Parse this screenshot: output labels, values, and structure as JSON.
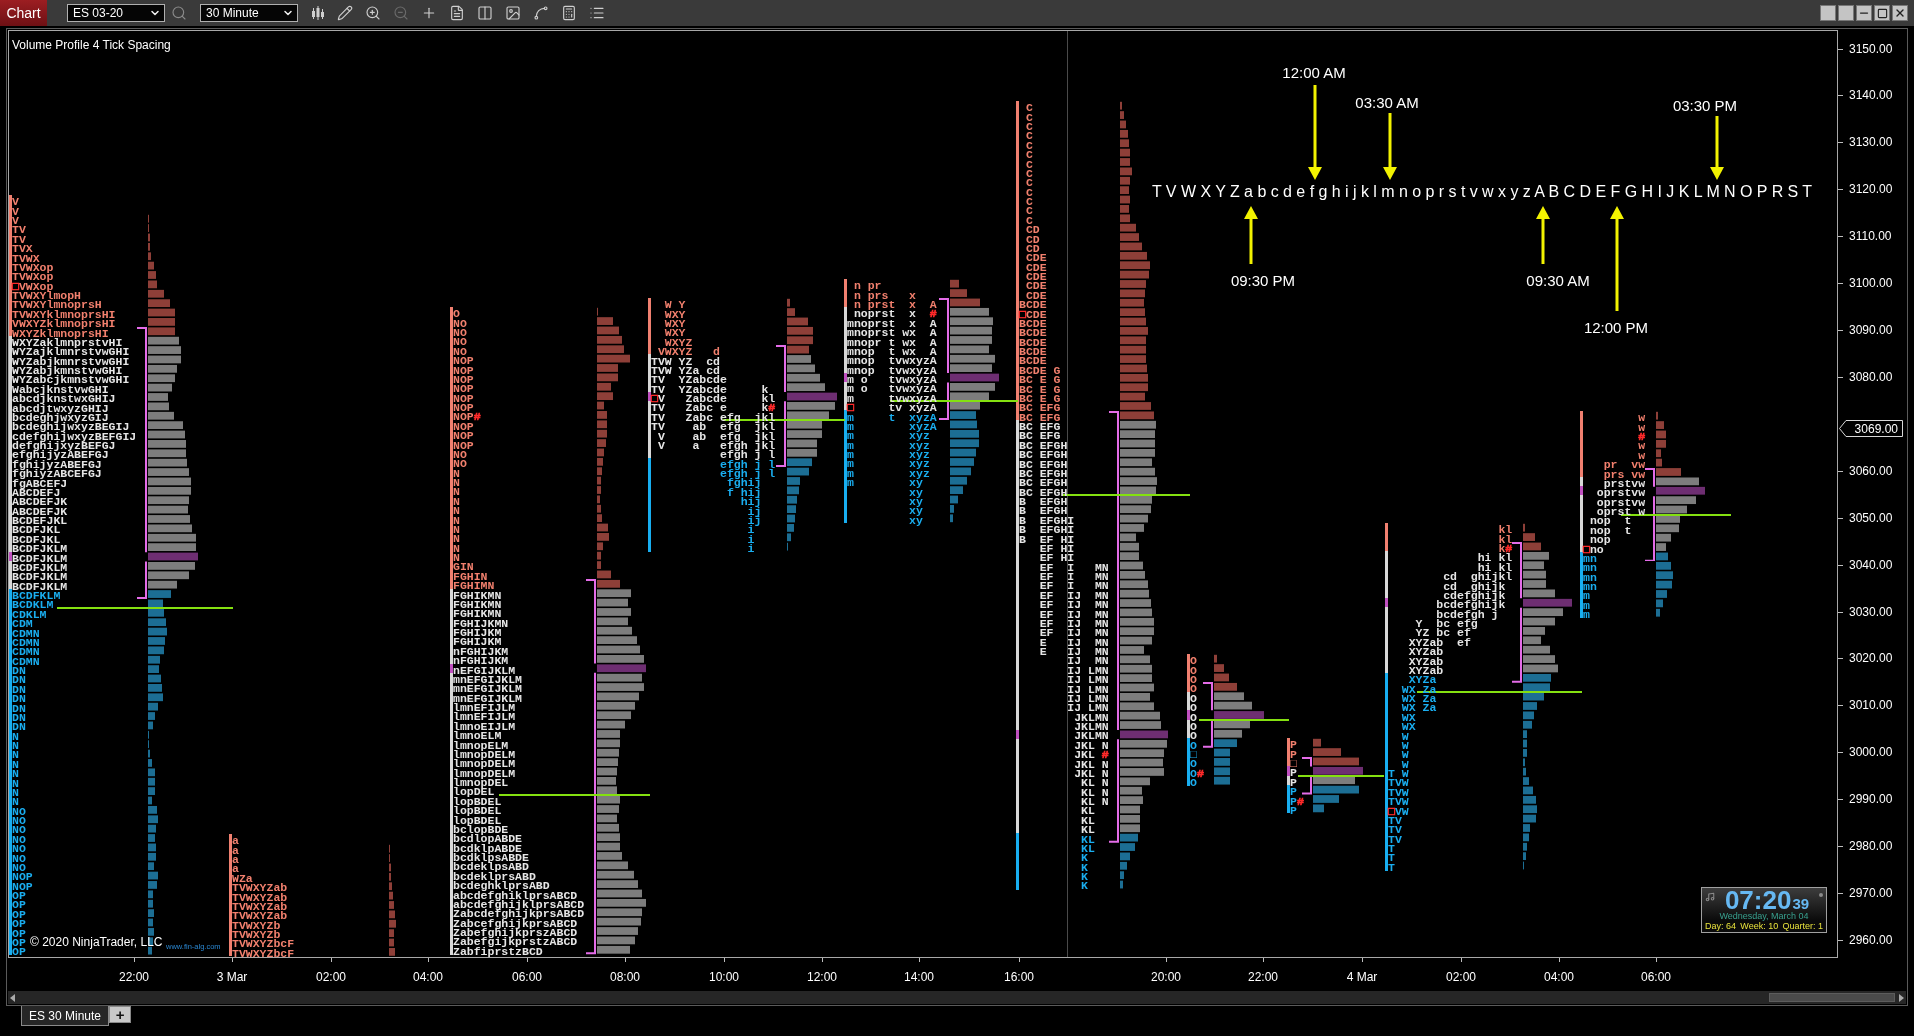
{
  "toolbar": {
    "label": "Chart",
    "instrument": "ES 03-20",
    "interval": "30 Minute"
  },
  "chart": {
    "title": "Volume Profile 4 Tick Spacing",
    "profiles": [
      {
        "segments": [
          {
            "kind": "upper",
            "rows": [
              "V",
              "V",
              "V",
              "TV",
              "TV",
              "TVX",
              "TVWX",
              "TVWXop",
              "TVWXop",
              "**□**VWXop",
              "TVWXYlmopH",
              "TVWXYlmnoprsH",
              "TVWXYklmnoprsHI",
              "VWXYZklmnoprsHI",
              "WXYZklmnoprsHI"
            ]
          },
          {
            "kind": "value",
            "rows": [
              "WXYZaklmnprstvHI",
              "WYZajklmnrstvwGHI",
              "WYZabjkmnrstvwGHI",
              "WYZabjkmnstvwGHI",
              "WYZabcjkmnstvwGHI",
              "WabcjknstvwGHI",
              "abcdjknstwxGHIJ",
              "abcdjtwxyzGHIJ",
              "bcdeghjwxyzGIJ",
              "bcdeghijwxyzBEGIJ",
              "cdefghijwxyzBEFGIJ",
              "defghijxyzBEFGJ",
              "efghijyzABEFGJ",
              "fghijyzABEFGJ",
              "fghiyzABCEFGJ",
              "fgABCEFJ",
              "ABCDEFJ",
              "ABCDEFJK",
              "ABCDEFJK",
              "BCDEFJKL",
              "BCDFJKL",
              "BCDFJKL",
              "BCDFJKLM"
            ]
          },
          {
            "kind": "poc",
            "rows": [
              "BCDFJKLM"
            ]
          },
          {
            "kind": "value",
            "rows": [
              "BCDFJKLM",
              "BCDFJKLM",
              "BCDFJKLM"
            ]
          },
          {
            "kind": "lower",
            "rows": [
              "BCDFKLM",
              "BCDKLM",
              "CDKLM",
              "CDM",
              "CDMN",
              "CDMN",
              "CDMN",
              "CDMN",
              "DN",
              "DN",
              "DN",
              "DN",
              "DN",
              "DN",
              "DN",
              "N",
              "N",
              "N",
              "N",
              "N",
              "N",
              "N",
              "N",
              "NO",
              "NO",
              "NO",
              "NO",
              "NO",
              "NO",
              "NO",
              "NOP",
              "NOP",
              "OP",
              "OP",
              "OP",
              "OP",
              "OP",
              "OP",
              "OP"
            ]
          }
        ]
      },
      {
        "segments": [
          {
            "kind": "upper",
            "rows": [
              "a",
              "a",
              "a",
              "a",
              "WZa",
              "TVWXYZab",
              "TVWXYZab",
              "TVWXYZab",
              "TVWXYZab",
              "TVWXYZb",
              "TVWXYZb",
              "TVWXYZbcF",
              "TVWXYZbcF"
            ]
          }
        ]
      },
      {
        "segments": [
          {
            "kind": "upper",
            "rows": [
              "O",
              "NO",
              "NO",
              "NO",
              "NO",
              "NOP",
              "NOP",
              "NOP",
              "NOP",
              "NOP",
              "NOP",
              "NOP**#**",
              "NOP",
              "NOP",
              "NOP",
              "NO",
              "NO",
              "N",
              "N",
              "N",
              "N",
              "N",
              "N",
              "N",
              "N",
              "N",
              "N",
              "GIN",
              "FGHIN",
              "FGHIMN"
            ]
          },
          {
            "kind": "value",
            "rows": [
              "FGHIKMN",
              "FGHIKMN",
              "FGHIKMN",
              "FGHIJKMN",
              "FGHIJKM",
              "FGHIJKM",
              "nFGHIJKM",
              "nFGHIJKM"
            ]
          },
          {
            "kind": "poc",
            "rows": [
              "nEFGIJKLM"
            ]
          },
          {
            "kind": "value",
            "rows": [
              "mnEFGIJKLM",
              "mnEFGIJKLM",
              "mnEFGIJKLM",
              "lmnEFIJLM",
              "lmnEFIJLM",
              "lmnoEIJLM",
              "lmnoELM",
              "lmnopELM",
              "lmnopDELM",
              "lmnopDELM",
              "lmnopDELM",
              "lmnopDEL",
              "lopDEL",
              "lopBDEL",
              "lopBDEL",
              "lopBDEL",
              "bclopBDE",
              "bcdlopABDE",
              "bcdklpABDE",
              "bcdklpsABDE",
              "bcdeklpsABD",
              "bcdeklprsABD",
              "bcdeghklprsABD",
              "abcdefghiklprsABCD",
              "abcdefghijklprsABCD",
              "ZabcdefghijkprsABCD",
              "ZabcefghijkprsABCD",
              "ZabefghijkprszABCD",
              "ZabefgijkprstzABCD",
              "ZabfiprstzBCD"
            ]
          }
        ]
      },
      {
        "segments": [
          {
            "kind": "upper",
            "rows": [
              "  W Y",
              "  WXY",
              "  WXY",
              "  WXY",
              "  WXYZ",
              " VWXYZ   d"
            ]
          },
          {
            "kind": "value",
            "rows": [
              "TVW YZ  cd",
              "TVW YZa cd",
              "TV  YZabcde",
              "TV  YZabcde     k"
            ]
          },
          {
            "kind": "poc",
            "rows": [
              "**□**V   Zabcde     kl"
            ]
          },
          {
            "kind": "value",
            "rows": [
              "TV   Zabc e     k**#**",
              "TV   Zabc efg  jkl",
              "TV    ab  efg  jkl",
              " V    ab  efg  jkl",
              " V    a   efgh jkl",
              "          efgh j l"
            ]
          },
          {
            "kind": "lower",
            "rows": [
              "          efgh j l",
              "          efgh j l",
              "           fghij",
              "           f hij",
              "             hij",
              "              ij",
              "              ij",
              "              i",
              "              i",
              "              i"
            ]
          }
        ]
      },
      {
        "segments": [
          {
            "kind": "upper",
            "rows": [
              " n pr",
              " n prs   x",
              " n prst  x  A"
            ]
          },
          {
            "kind": "value",
            "rows": [
              " noprst  x  **#**",
              "mnoprst  x  A",
              "mnoprst wx  A",
              "mnopr t wx  A",
              "mnop  t wx  A",
              "mnop  tvwxyzA",
              "mnop  tvwxyzA"
            ]
          },
          {
            "kind": "poc",
            "rows": [
              "m o   tvwxyzA"
            ]
          },
          {
            "kind": "value",
            "rows": [
              "m o   tvwxyzA",
              "m     tvwxyzA",
              "**□**     tv xyzA"
            ]
          },
          {
            "kind": "lower",
            "rows": [
              "m     t  xyzA",
              "m        xyzA",
              "m        xyz",
              "m        xyz",
              "m        xyz",
              "m        xyz",
              "m        xyz",
              "m        xy",
              "         xy",
              "         xy",
              "         xy",
              "         xy"
            ]
          }
        ]
      },
      {
        "segments": [
          {
            "kind": "upper",
            "rows": [
              " C",
              " C",
              " C",
              " C",
              " C",
              " C",
              " C",
              " C",
              " C",
              " C",
              " C",
              " C",
              " C",
              " CD",
              " CD",
              " CD",
              " CDE",
              " CDE",
              " CDE",
              " CDE",
              " CDE",
              "BCDE",
              "**□**CDE",
              "BCDE",
              "BCDE",
              "BCDE",
              "BCDE",
              "BCDE",
              "BCDE G",
              "BC E G",
              "BC E G",
              "BC E G",
              "BC EFG",
              "BC EFG"
            ]
          },
          {
            "kind": "value",
            "rows": [
              "BC EFG",
              "BC EFG",
              "BC EFGH",
              "BC EFGH",
              "BC EFGH",
              "BC EFGH",
              "BC EFGH",
              "BC EFGH",
              "B  EFGH",
              "B  EFGH",
              "B  EFGHI",
              "B  EFGHI",
              "B  EF HI",
              "   EF HI",
              "   EF HI",
              "   EF  I   MN",
              "   EF  I   MN",
              "   EF  I   MN",
              "   EF  IJ  MN",
              "   EF  IJ  MN",
              "   EF  IJ  MN",
              "   EF  IJ  MN",
              "   EF  IJ  MN",
              "   E   IJ  MN",
              "   E   IJ  MN",
              "       IJ  MN",
              "       IJ LMN",
              "       IJ LMN",
              "       IJ LMN",
              "       IJ LMN",
              "       IJ LMN",
              "        JKLMN",
              "        JKLMN"
            ]
          },
          {
            "kind": "poc",
            "rows": [
              "        JKLMN"
            ]
          },
          {
            "kind": "value",
            "rows": [
              "        JKL N",
              "        JKL **#**",
              "        JKL N",
              "        JKL N",
              "         KL N",
              "         KL N",
              "         KL N",
              "         KL",
              "         KL",
              "         KL"
            ]
          },
          {
            "kind": "lower",
            "rows": [
              "         KL",
              "         KL",
              "         K",
              "         K",
              "         K",
              "         K"
            ]
          }
        ]
      },
      {
        "segments": [
          {
            "kind": "upper",
            "rows": [
              "O",
              "O",
              "O",
              "O"
            ]
          },
          {
            "kind": "value",
            "rows": [
              "O",
              "O"
            ]
          },
          {
            "kind": "poc",
            "rows": [
              "O"
            ]
          },
          {
            "kind": "value",
            "rows": [
              "O",
              "O"
            ]
          },
          {
            "kind": "lower",
            "rows": [
              "O",
              "□",
              "O",
              "O**#**",
              "O"
            ]
          }
        ]
      },
      {
        "segments": [
          {
            "kind": "upper",
            "rows": [
              "P",
              "P",
              "□"
            ]
          },
          {
            "kind": "poc",
            "rows": [
              "P"
            ]
          },
          {
            "kind": "value",
            "rows": [
              "P"
            ]
          },
          {
            "kind": "lower",
            "rows": [
              "P",
              "P**#**",
              "P"
            ]
          }
        ]
      },
      {
        "segments": [
          {
            "kind": "upper",
            "rows": [
              "                kl",
              "                kl",
              "                k**#**"
            ]
          },
          {
            "kind": "value",
            "rows": [
              "             hi kl",
              "             hi kl",
              "        cd  ghijkl",
              "        cd  ghijk",
              "        cdefghijk"
            ]
          },
          {
            "kind": "poc",
            "rows": [
              "       bcdefghijk"
            ]
          },
          {
            "kind": "value",
            "rows": [
              "       bcdefgh j",
              "    Y  bc efg",
              "    YZ bc ef",
              "   XYZab  ef",
              "   XYZab",
              "   XYZab",
              "   XYZab"
            ]
          },
          {
            "kind": "lower",
            "rows": [
              "   XYZa",
              "  WX Za",
              "  WX Za",
              "  WX Za",
              "  WX",
              "  WX",
              "  W",
              "  W",
              "  W",
              "  W",
              "T W",
              "TVW",
              "TVW",
              "TVW",
              "**□**VW",
              "TV",
              "TV",
              "TV",
              "T",
              "T",
              "T"
            ]
          }
        ]
      },
      {
        "segments": [
          {
            "kind": "upper",
            "rows": [
              "        w",
              "        w",
              "        **#**",
              "        w",
              "        w",
              "   pr  vw",
              "   prs vw"
            ]
          },
          {
            "kind": "value",
            "rows": [
              "   prstvw"
            ]
          },
          {
            "kind": "poc",
            "rows": [
              "  oprstvw"
            ]
          },
          {
            "kind": "value",
            "rows": [
              "  oprstvw",
              "  oprst w",
              " nop  t",
              " nop  t",
              " nop",
              "**□**no"
            ]
          },
          {
            "kind": "lower",
            "rows": [
              "mn",
              "mn",
              "mn",
              "mn",
              "m",
              "m",
              "m"
            ]
          }
        ]
      }
    ],
    "annotation": {
      "sequence": "T V W X Y Z a b c d e f g h i j k l m n o p r s t v w x y z A B C D E F G H I J K L M N O P R S T",
      "markers": [
        {
          "label": "12:00 AM",
          "kind": "down"
        },
        {
          "label": "03:30 AM",
          "kind": "down"
        },
        {
          "label": "03:30 PM",
          "kind": "down"
        },
        {
          "label": "09:30 PM",
          "kind": "up"
        },
        {
          "label": "09:30 AM",
          "kind": "up"
        },
        {
          "label": "12:00 PM",
          "kind": "up"
        }
      ]
    },
    "copyright": "© 2020 NinjaTrader, LLC",
    "website": "www.fin-alg.com",
    "clock": {
      "time": "07:20",
      "seconds": "39",
      "date": "Wednesday, March 04",
      "day": "Day: 64",
      "week": "Week: 10",
      "quarter": "Quarter: 1"
    }
  },
  "price_axis": {
    "labels": [
      "3150.00",
      "3140.00",
      "3130.00",
      "3120.00",
      "3110.00",
      "3100.00",
      "3090.00",
      "3080.00",
      "3060.00",
      "3050.00",
      "3040.00",
      "3030.00",
      "3020.00",
      "3010.00",
      "3000.00",
      "2990.00",
      "2980.00",
      "2970.00",
      "2960.00"
    ],
    "current_price": "3069.00"
  },
  "time_axis": {
    "labels": [
      "22:00",
      "3 Mar",
      "02:00",
      "04:00",
      "06:00",
      "08:00",
      "10:00",
      "12:00",
      "14:00",
      "16:00",
      "20:00",
      "22:00",
      "4 Mar",
      "02:00",
      "04:00",
      "06:00"
    ]
  },
  "tabs": [
    {
      "label": "ES 30 Minute",
      "selected": true
    }
  ],
  "add_tab": "+"
}
